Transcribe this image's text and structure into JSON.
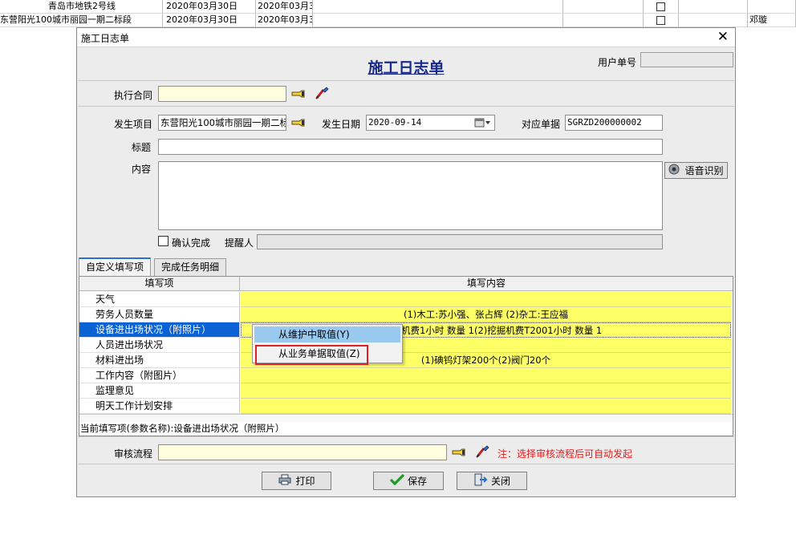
{
  "bg_rows": [
    {
      "project": "青岛市地铁2号线",
      "date1": "2020年03月30日",
      "date2": "2020年03月3",
      "person": ""
    },
    {
      "project": "东营阳光100城市丽园一期二标段",
      "date1": "2020年03月30日",
      "date2": "2020年03月3",
      "person": "邓璇"
    }
  ],
  "dialog": {
    "window_title": "施工日志单",
    "close_glyph": "✕",
    "main_title": "施工日志单",
    "user_no_label": "用户单号",
    "user_no_value": ""
  },
  "form": {
    "contract_label": "执行合同",
    "contract_value": "",
    "project_label": "发生项目",
    "project_value": "东营阳光100城市丽园一期二标",
    "date_label": "发生日期",
    "date_value": "2020-09-14",
    "doc_label": "对应单据",
    "doc_value": "SGRZD200000002",
    "title_label": "标题",
    "title_value": "",
    "content_label": "内容",
    "content_value": "",
    "voice_button": "语音识别",
    "confirm_label": "确认完成",
    "remind_label": "提醒人",
    "remind_value": ""
  },
  "tabs": [
    {
      "label": "自定义填写项",
      "active": true
    },
    {
      "label": "完成任务明细",
      "active": false
    }
  ],
  "grid": {
    "col_name": "填写项",
    "col_value": "填写内容",
    "rows": [
      {
        "name": "天气",
        "value": "",
        "selected": false
      },
      {
        "name": "劳务人员数量",
        "value": "(1)木工:苏小强、张占辉 (2)杂工:王应福",
        "selected": false
      },
      {
        "name": "设备进出场状况（附照片）",
        "value": "(1)挖掘机费1小时 数量 1(2)挖掘机费T2001小时 数量 1",
        "selected": true
      },
      {
        "name": "人员进出场状况",
        "value": "",
        "selected": false
      },
      {
        "name": "材料进出场",
        "value": "(1)碘钨灯架200个(2)阀门20个",
        "selected": false
      },
      {
        "name": "工作内容（附图片）",
        "value": "",
        "selected": false
      },
      {
        "name": "监理意见",
        "value": "",
        "selected": false
      },
      {
        "name": "明天工作计划安排",
        "value": "",
        "selected": false
      }
    ],
    "status": "当前填写项(参数名称):设备进出场状况（附照片）"
  },
  "context_menu": {
    "items": [
      "从维护中取值(Y)",
      "从业务单据取值(Z)"
    ]
  },
  "approval": {
    "label": "审核流程",
    "value": "",
    "note": "注：选择审核流程后可自动发起"
  },
  "buttons": {
    "print": "打印",
    "save": "保存",
    "close": "关闭"
  },
  "colors": {
    "title_blue": "#1a2b8c",
    "selection_blue": "#0a62d4",
    "cell_yellow": "#ffff66",
    "note_red": "#e02020",
    "menu_highlight": "#99c9ef"
  }
}
